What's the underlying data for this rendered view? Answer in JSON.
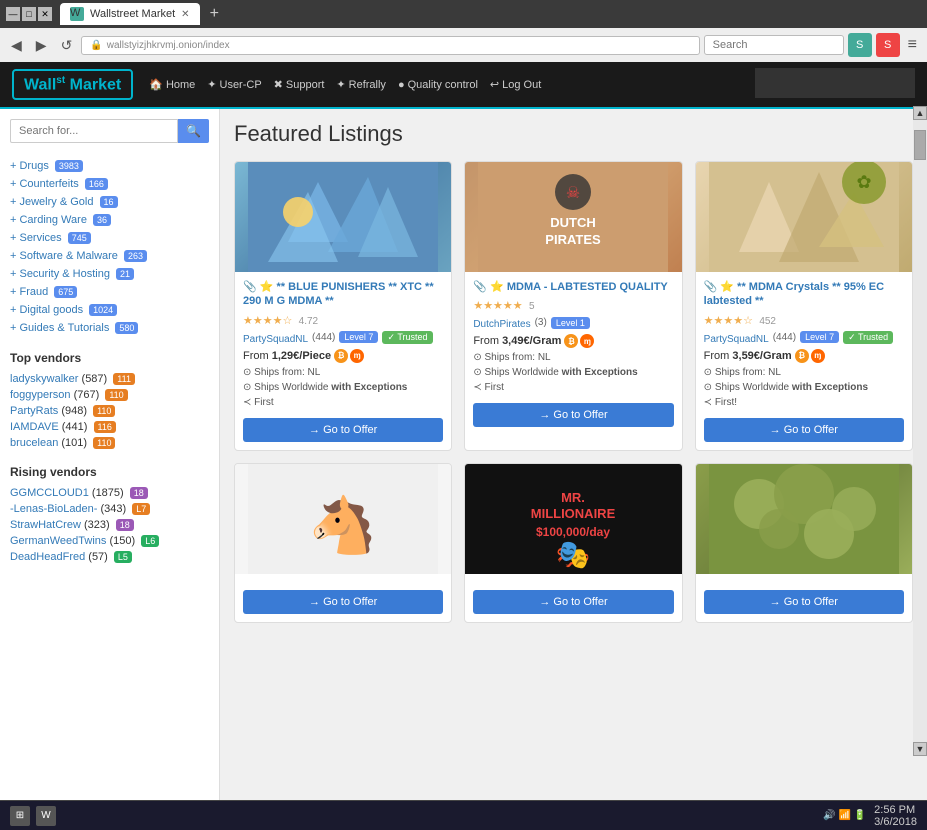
{
  "browser": {
    "tab_title": "Wallstreet Market",
    "url": "wallstyizjhkrvmj.onion/index",
    "search_placeholder": "Search",
    "new_tab_label": "+"
  },
  "site": {
    "logo": "Wall Market",
    "logo_superscript": "st",
    "nav": [
      {
        "label": "Home",
        "icon": "🏠"
      },
      {
        "label": "User-CP",
        "icon": "✦"
      },
      {
        "label": "Support",
        "icon": "✖"
      },
      {
        "label": "Refrally",
        "icon": "✦"
      },
      {
        "label": "Quality control",
        "icon": "●"
      },
      {
        "label": "Log Out",
        "icon": "↩"
      }
    ]
  },
  "sidebar": {
    "search_placeholder": "Search for...",
    "categories": [
      {
        "label": "Drugs",
        "badge": "3983",
        "badge_type": "blue"
      },
      {
        "label": "Counterfeits",
        "badge": "166",
        "badge_type": "blue"
      },
      {
        "label": "Jewelry & Gold",
        "badge": "16",
        "badge_type": "blue"
      },
      {
        "label": "Carding Ware",
        "badge": "36",
        "badge_type": "blue"
      },
      {
        "label": "Services",
        "badge": "745",
        "badge_type": "blue"
      },
      {
        "label": "Software & Malware",
        "badge": "263",
        "badge_type": "blue"
      },
      {
        "label": "Security & Hosting",
        "badge": "21",
        "badge_type": "blue"
      },
      {
        "label": "Fraud",
        "badge": "675",
        "badge_type": "blue"
      },
      {
        "label": "Digital goods",
        "badge": "1024",
        "badge_type": "blue"
      },
      {
        "label": "Guides & Tutorials",
        "badge": "580",
        "badge_type": "blue"
      }
    ],
    "top_vendors_title": "Top vendors",
    "top_vendors": [
      {
        "name": "ladyskywalker",
        "count": "587",
        "level": "111",
        "level_class": "l7"
      },
      {
        "name": "foggyperson",
        "count": "767",
        "level": "110",
        "level_class": "l7"
      },
      {
        "name": "PartyRats",
        "count": "948",
        "level": "110",
        "level_class": "l7"
      },
      {
        "name": "IAMDAVE",
        "count": "441",
        "level": "116",
        "level_class": "l7"
      },
      {
        "name": "brucelean",
        "count": "101",
        "level": "110",
        "level_class": "l7"
      }
    ],
    "rising_vendors_title": "Rising vendors",
    "rising_vendors": [
      {
        "name": "GGMCCLOUD1",
        "count": "1875",
        "level": "18",
        "level_class": "l8"
      },
      {
        "name": "-Lenas-BioLaden-",
        "count": "343",
        "level": "L7",
        "level_class": "l7"
      },
      {
        "name": "StrawHatCrew",
        "count": "323",
        "level": "18",
        "level_class": "l8"
      },
      {
        "name": "GermanWeedTwins",
        "count": "150",
        "level": "L6",
        "level_class": "l6"
      },
      {
        "name": "DeadHeadFred",
        "count": "57",
        "level": "L5",
        "level_class": "l6"
      }
    ]
  },
  "content": {
    "page_title": "Featured Listings",
    "listings": [
      {
        "id": 1,
        "title": "📎 ⭐ ** BLUE PUNISHERS ** XTC ** 290 M G MDMA **",
        "stars": 4,
        "rating": "4.72",
        "img_type": "blue_crystals",
        "seller": "PartySquadNL",
        "seller_count": "444",
        "level": "Level 7",
        "trusted": "Trusted",
        "price": "1,29€/Piece",
        "ships_from": "NL",
        "ships_worldwide": "Ships Worldwide with Exceptions",
        "first": "First",
        "crypto": [
          "btc",
          "xmr"
        ],
        "go_label": "→ Go to Offer"
      },
      {
        "id": 2,
        "title": "📎 ⭐ MDMA - LABTESTED QUALITY",
        "stars": 5,
        "rating": "5",
        "img_type": "dutch_pirates",
        "seller": "DutchPirates",
        "seller_count": "3",
        "level": "Level 1",
        "trusted": "",
        "price": "3,49€/Gram",
        "ships_from": "NL",
        "ships_worldwide": "Ships Worldwide with Exceptions",
        "first": "First",
        "crypto": [
          "btc",
          "xmr"
        ],
        "go_label": "→ Go to Offer"
      },
      {
        "id": 3,
        "title": "📎 ⭐ ** MDMA Crystals ** 95% EC labtested **",
        "stars": 4,
        "rating": "452",
        "img_type": "mdma_crystals",
        "seller": "PartySquadNL",
        "seller_count": "444",
        "level": "Level 7",
        "trusted": "Trusted",
        "price": "3,59€/Gram",
        "ships_from": "NL",
        "ships_worldwide": "Ships Worldwide with Exceptions",
        "first": "First",
        "crypto": [
          "btc",
          "xmr"
        ],
        "go_label": "→ Go to Offer"
      },
      {
        "id": 4,
        "title": "",
        "img_type": "donkey",
        "go_label": "→ Go to Offer"
      },
      {
        "id": 5,
        "title": "MR. MILLIONAIRE $100,000/day",
        "img_type": "mr_millionaire",
        "go_label": "→ Go to Offer"
      },
      {
        "id": 6,
        "title": "",
        "img_type": "weed",
        "go_label": "→ Go to Offer"
      }
    ]
  },
  "taskbar": {
    "time": "2:56 PM",
    "date": "3/6/2018"
  }
}
